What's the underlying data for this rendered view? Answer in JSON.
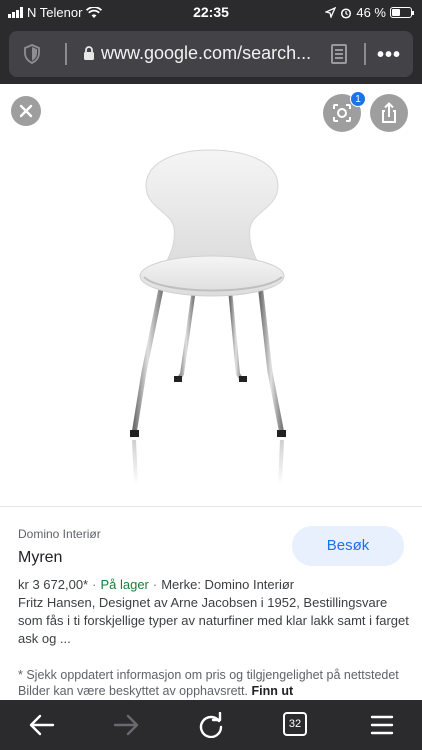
{
  "status_bar": {
    "carrier": "N Telenor",
    "time": "22:35",
    "battery_text": "46 %",
    "battery_level": 0.46
  },
  "browser": {
    "url": "www.google.com/search...",
    "tab_count": "32"
  },
  "overlay": {
    "lens_badge_count": "1"
  },
  "result": {
    "source": "Domino Interiør",
    "title": "Myren",
    "visit_label": "Besøk",
    "price": "kr 3 672,00*",
    "stock": "På lager",
    "brand": "Merke: Domino Interiør",
    "description": "Fritz Hansen, Designet av Arne Jacobsen i 1952, Bestillingsvare som fås i ti forskjellige typer av naturfiner med klar lakk samt i farget ask og ...",
    "disclaimer": "* Sjekk oppdatert informasjon om pris og tilgjengelighet på nettstedet Bilder kan være beskyttet av opphavsrett.",
    "disclaimer_link": "Finn ut"
  },
  "icons": [
    "signal-bars-icon",
    "wifi-icon",
    "location-arrow-icon",
    "alarm-icon",
    "battery-icon",
    "shield-icon",
    "lock-icon",
    "reader-icon",
    "more-icon",
    "close-icon",
    "lens-icon",
    "share-icon",
    "back-icon",
    "forward-icon",
    "reload-icon",
    "tabs-icon",
    "menu-icon"
  ],
  "colors": {
    "chrome_bg": "#2b2b2d",
    "url_field_bg": "#434347",
    "visit_button_bg": "#e8f0fe",
    "visit_button_text": "#1a73e8",
    "in_stock": "#188038",
    "overlay_button": "#9e9e9e"
  }
}
